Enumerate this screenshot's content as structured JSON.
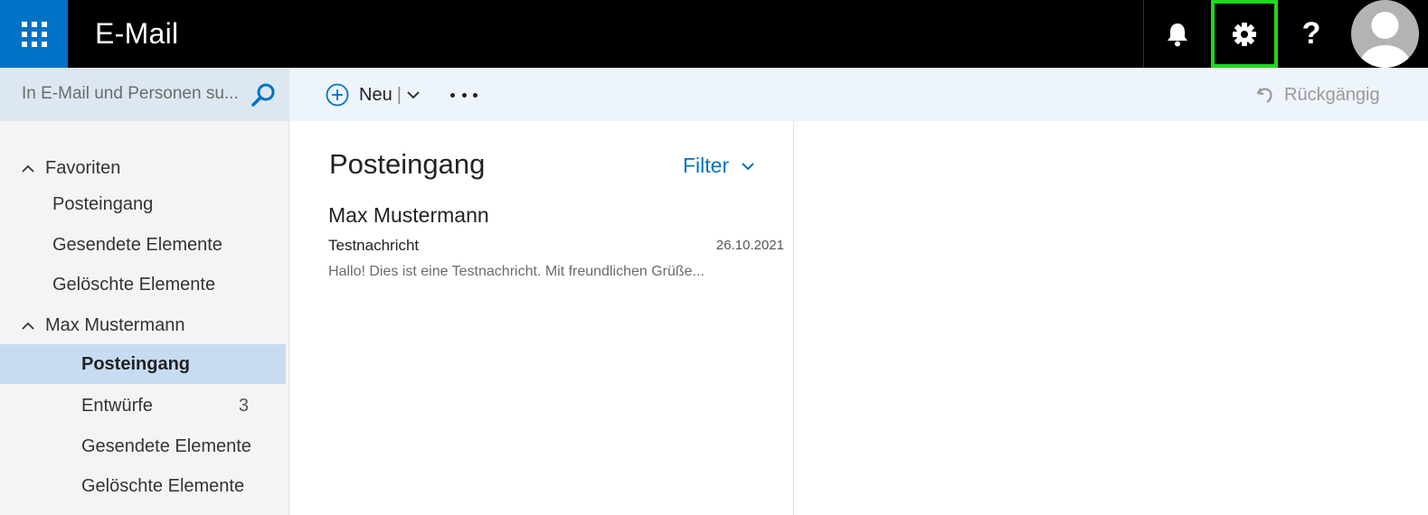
{
  "header": {
    "app_title": "E-Mail",
    "icons": [
      "app-launcher-icon",
      "bell-icon",
      "gear-icon",
      "help-icon",
      "avatar-icon"
    ],
    "help_glyph": "?",
    "highlight_color": "#1fd81f",
    "brand_color": "#0072c6"
  },
  "search": {
    "placeholder": "In E-Mail und Personen su..."
  },
  "toolbar": {
    "new_label": "Neu",
    "new_separator": "|",
    "undo_label": "Rückgängig"
  },
  "sidebar": {
    "groups": [
      {
        "label": "Favoriten",
        "items": [
          {
            "label": "Posteingang",
            "count": ""
          },
          {
            "label": "Gesendete Elemente",
            "count": ""
          },
          {
            "label": "Gelöschte Elemente",
            "count": ""
          }
        ]
      },
      {
        "label": "Max Mustermann",
        "items": [
          {
            "label": "Posteingang",
            "count": "",
            "selected": true
          },
          {
            "label": "Entwürfe",
            "count": "3"
          },
          {
            "label": "Gesendete Elemente",
            "count": ""
          },
          {
            "label": "Gelöschte Elemente",
            "count": ""
          }
        ]
      }
    ]
  },
  "message_list": {
    "folder_title": "Posteingang",
    "filter_label": "Filter",
    "messages": [
      {
        "sender": "Max Mustermann",
        "subject": "Testnachricht",
        "date": "26.10.2021",
        "preview": "Hallo! Dies ist eine Testnachricht. Mit freundlichen Grüße..."
      }
    ]
  }
}
